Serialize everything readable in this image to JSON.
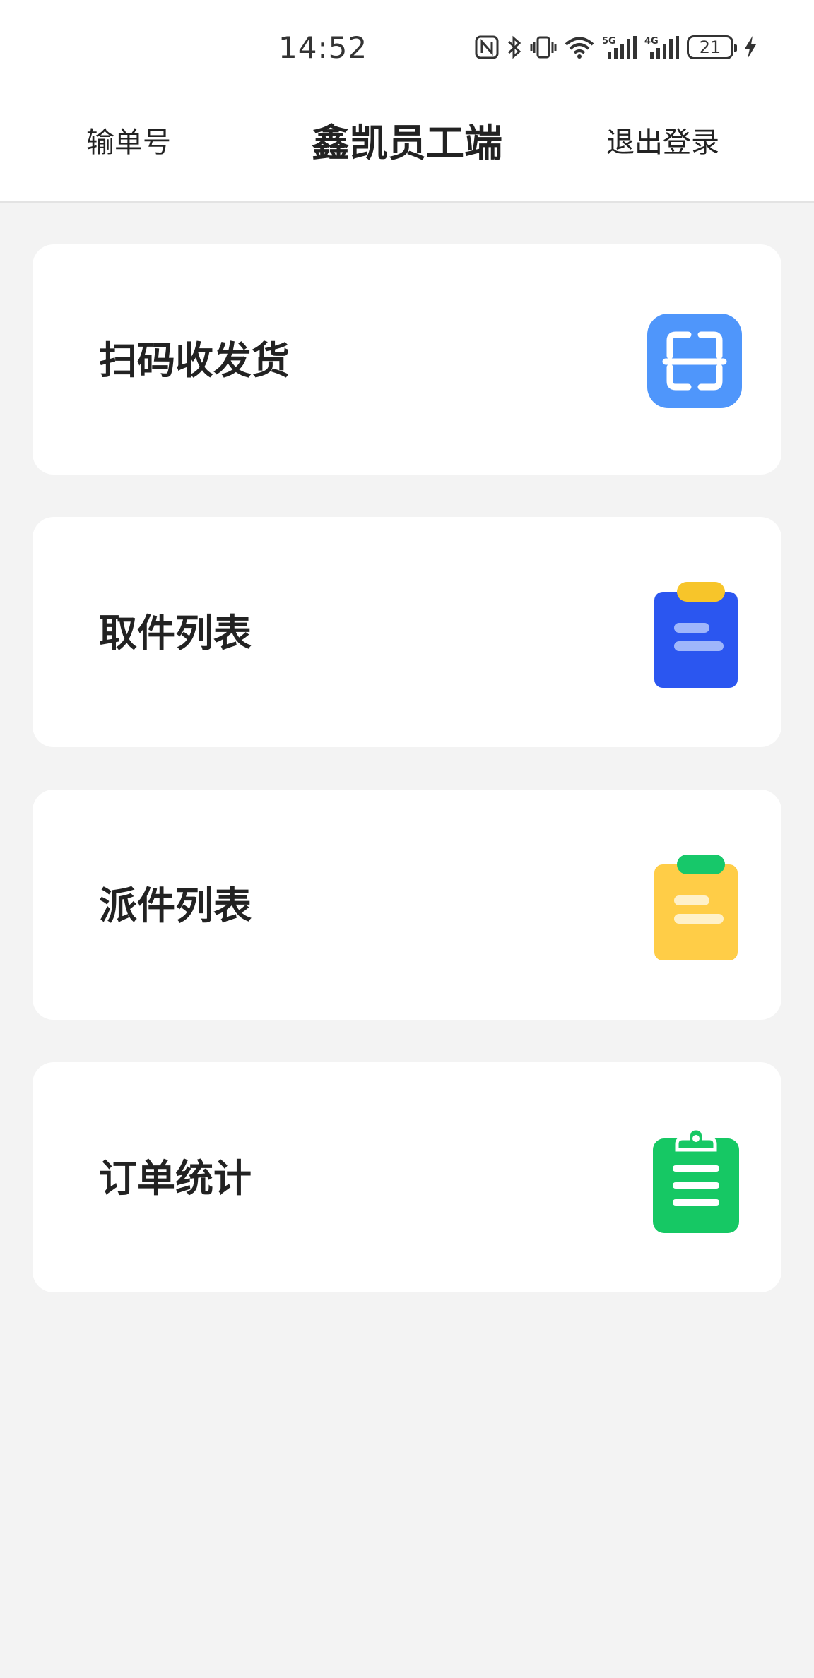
{
  "status_bar": {
    "time": "14:52",
    "battery_level": "21",
    "icons": [
      "nfc-icon",
      "bluetooth-icon",
      "vibrate-icon",
      "wifi-icon",
      "signal-5g-icon",
      "signal-4g-icon",
      "battery-icon",
      "charging-icon"
    ],
    "signal_labels": [
      "5G",
      "4G"
    ]
  },
  "navbar": {
    "left_label": "输单号",
    "title": "鑫凯员工端",
    "right_label": "退出登录"
  },
  "menu": [
    {
      "label": "扫码收发货",
      "icon": "scan-icon",
      "color": "#4f96fb"
    },
    {
      "label": "取件列表",
      "icon": "clipboard-blue-icon",
      "color": "#2b56f0",
      "accent": "#f7c52a"
    },
    {
      "label": "派件列表",
      "icon": "clipboard-yellow-icon",
      "color": "#ffcd47",
      "accent": "#17c86a"
    },
    {
      "label": "订单统计",
      "icon": "clipboard-green-icon",
      "color": "#16c864"
    }
  ]
}
